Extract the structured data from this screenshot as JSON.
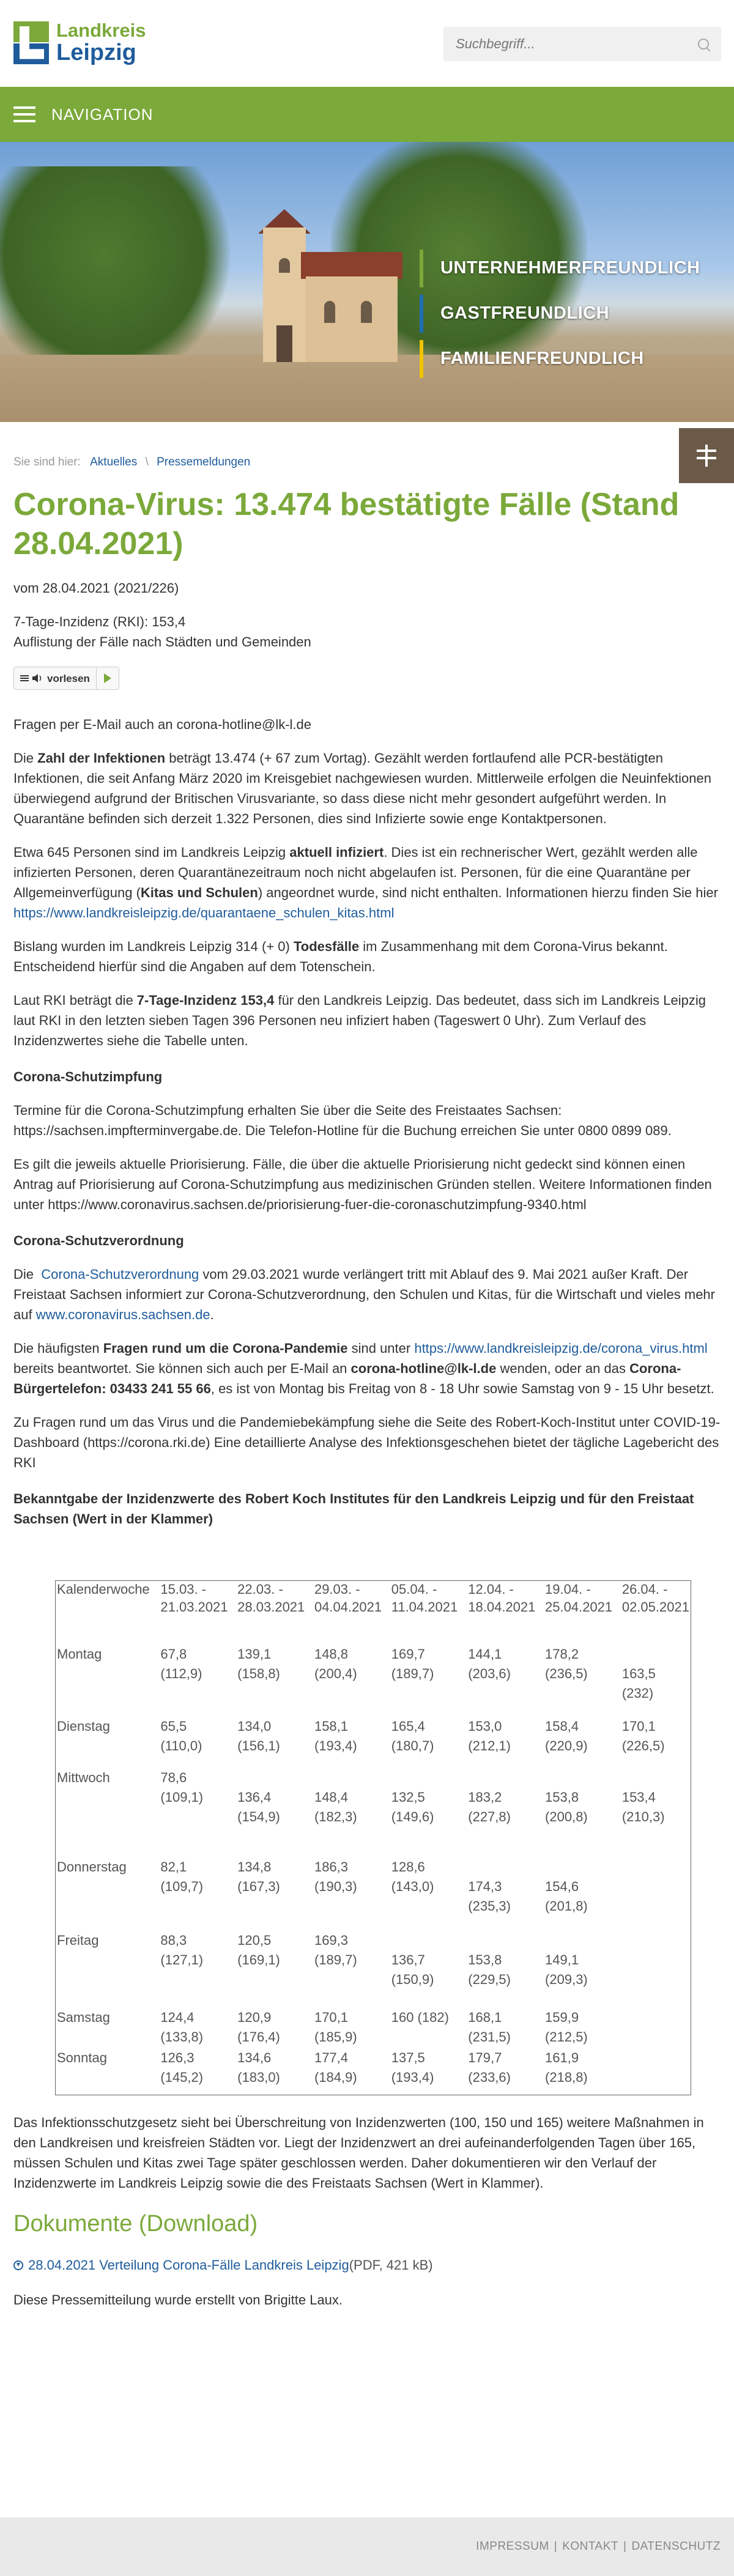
{
  "header": {
    "logo_top": "Landkreis",
    "logo_bottom": "Leipzig",
    "search_placeholder": "Suchbegriff..."
  },
  "nav": {
    "label": "NAVIGATION"
  },
  "hero": {
    "slogans": [
      "UNTERNEHMERFREUNDLICH",
      "GASTFREUNDLICH",
      "FAMILIENFREUNDLICH"
    ]
  },
  "breadcrumb": {
    "prefix": "Sie sind hier:",
    "items": [
      "Aktuelles",
      "Pressemeldungen"
    ],
    "separator": "\\"
  },
  "article": {
    "title": "Corona-Virus: 13.474 bestätigte Fälle (Stand 28.04.2021)",
    "date": "vom 28.04.2021 (2021/226)",
    "incidence_line": "7-Tage-Inzidenz (RKI): 153,4",
    "list_line": "Auflistung der Fälle nach Städten und Gemeinden",
    "listen_label": "vorlesen",
    "email_line": "Fragen per E-Mail auch an corona-hotline@lk-l.de",
    "p_infections_a": "Die ",
    "p_infections_b": "Zahl der Infektionen",
    "p_infections_c": " beträgt 13.474 (+ 67 zum Vortag). Gezählt werden fortlaufend alle PCR-bestätigten Infektionen, die seit Anfang März 2020 im Kreisgebiet nachgewiesen wurden. Mittlerweile erfolgen die Neuinfektionen überwiegend aufgrund der Britischen Virusvariante, so dass diese nicht mehr gesondert aufgeführt werden. In Quarantäne befinden sich derzeit 1.322 Personen, dies sind Infizierte sowie enge Kontaktpersonen.",
    "p_active_a": "Etwa 645 Personen sind im Landkreis Leipzig ",
    "p_active_b": "aktuell infiziert",
    "p_active_c": ". Dies ist ein rechnerischer Wert, gezählt werden alle infizierten Personen, deren Quarantänezeitraum noch nicht abgelaufen ist. Personen, für die eine Quarantäne per Allgemeinverfügung (",
    "p_active_d": "Kitas und Schulen",
    "p_active_e": ") angeordnet wurde, sind nicht enthalten. Informationen hierzu finden Sie hier ",
    "p_active_link": "https://www.landkreisleipzig.de/quarantaene_schulen_kitas.html",
    "p_deaths_a": "Bislang wurden im Landkreis Leipzig 314 (+ 0) ",
    "p_deaths_b": "Todesfälle",
    "p_deaths_c": " im Zusammenhang mit dem Corona-Virus bekannt. Entscheidend hierfür sind die Angaben auf dem Totenschein.",
    "p_rki_a": "Laut RKI beträgt die ",
    "p_rki_b": "7-Tage-Inzidenz 153,4",
    "p_rki_c": " für den Landkreis Leipzig. Das bedeutet, dass sich im Landkreis Leipzig laut RKI in den letzten sieben Tagen 396 Personen neu infiziert haben (Tageswert 0 Uhr). Zum Verlauf des Inzidenzwertes siehe die Tabelle unten.",
    "h_vaccination": "Corona-Schutzimpfung",
    "p_vacc1": "Termine für die Corona-Schutzimpfung erhalten Sie über die Seite des Freistaates Sachsen: https://sachsen.impfterminvergabe.de. Die Telefon-Hotline für die Buchung erreichen Sie unter 0800 0899 089.",
    "p_vacc2": "Es gilt die jeweils aktuelle Priorisierung. Fälle, die über die aktuelle Priorisierung nicht gedeckt sind können einen Antrag auf Priorisierung auf Corona-Schutzimpfung aus medizinischen Gründen stellen. Weitere Informationen finden unter https://www.coronavirus.sachsen.de/priorisierung-fuer-die-coronaschutzimpfung-9340.html",
    "h_regulation": "Corona-Schutzverordnung",
    "p_reg_a": "Die  ",
    "p_reg_link1": "Corona-Schutzverordnung",
    "p_reg_b": " vom 29.03.2021 wurde verlängert tritt mit Ablauf des 9. Mai 2021 außer Kraft. Der Freistaat Sachsen informiert zur Corona-Schutzverordnung, den Schulen und Kitas, für die Wirtschaft und vieles mehr auf ",
    "p_reg_link2": "www.coronavirus.sachsen.de",
    "p_reg_c": ".",
    "p_faq_a": "Die häufigsten ",
    "p_faq_b": "Fragen rund um die Corona-Pandemie",
    "p_faq_c": " sind unter ",
    "p_faq_link": "https://www.landkreisleipzig.de/corona_virus.html",
    "p_faq_d": " bereits beantwortet. Sie können sich auch per E-Mail an ",
    "p_faq_e": "corona-hotline@lk-l.de",
    "p_faq_f": " wenden, oder an das ",
    "p_faq_g": "Corona-Bürgertelefon: 03433 241 55 66",
    "p_faq_h": ", es ist von Montag bis Freitag von 8 - 18 Uhr sowie Samstag von 9 - 15 Uhr besetzt.",
    "p_rki_site": "Zu Fragen rund um das Virus und die Pandemiebekämpfung siehe die Seite des Robert-Koch-Institut unter COVID-19-Dashboard (https://corona.rki.de)  Eine detaillierte Analyse des Infektionsgeschehen bietet der tägliche Lagebericht des RKI",
    "table_heading": "Bekanntgabe der Inzidenzwerte des Robert Koch Institutes für den Landkreis Leipzig und für den Freistaat Sachsen (Wert in der Klammer)",
    "p_law": "Das Infektionsschutzgesetz sieht bei Überschreitung von Inzidenzwerten (100, 150 und 165) weitere Maßnahmen in den Landkreisen und kreisfreien Städten vor. Liegt der Inzidenzwert an drei aufeinanderfolgenden Tagen über 165, müssen Schulen und Kitas zwei Tage später geschlossen werden. Daher dokumentieren wir den Verlauf der Inzidenzwerte im Landkreis Leipzig sowie die des Freistaats Sachsen (Wert in Klammer).",
    "h_documents": "Dokumente (Download)",
    "doc_link": "28.04.2021 Verteilung Corona-Fälle Landkreis Leipzig",
    "doc_meta": " (PDF, 421 kB)",
    "author": "Diese Pressemitteilung wurde erstellt von Brigitte Laux."
  },
  "incidence_table": {
    "header_label": "Kalenderwoche",
    "weeks": [
      [
        "15.03. -",
        "21.03.2021"
      ],
      [
        "22.03. -",
        "28.03.2021"
      ],
      [
        "29.03. -",
        "04.04.2021"
      ],
      [
        "05.04. -",
        "11.04.2021"
      ],
      [
        "12.04. -",
        "18.04.2021"
      ],
      [
        "19.04. -",
        "25.04.2021"
      ],
      [
        "26.04. -",
        "02.05.2021"
      ]
    ],
    "rows": [
      {
        "day": "Montag",
        "cells": [
          [
            "67,8",
            "(112,9)"
          ],
          [
            "139,1",
            "(158,8)"
          ],
          [
            "148,8",
            "(200,4)"
          ],
          [
            "169,7",
            "(189,7)"
          ],
          [
            "144,1",
            "(203,6)"
          ],
          [
            "178,2",
            "(236,5)"
          ],
          [
            "",
            "163,5 (232)"
          ]
        ]
      },
      {
        "day": "Dienstag",
        "cells": [
          [
            "65,5",
            "(110,0)"
          ],
          [
            "134,0",
            "(156,1)"
          ],
          [
            "158,1",
            "(193,4)"
          ],
          [
            "165,4",
            "(180,7)"
          ],
          [
            "153,0",
            "(212,1)"
          ],
          [
            "158,4",
            "(220,9)"
          ],
          [
            "170,1",
            "(226,5)"
          ]
        ]
      },
      {
        "day": "Mittwoch",
        "cells": [
          [
            "78,6",
            "(109,1)"
          ],
          [
            "",
            "136,4",
            "(154,9)"
          ],
          [
            "",
            "148,4",
            "(182,3)"
          ],
          [
            "",
            "132,5",
            "(149,6)"
          ],
          [
            "",
            "183,2",
            "(227,8)"
          ],
          [
            "",
            "153,8",
            "(200,8)"
          ],
          [
            "",
            "153,4",
            "(210,3)"
          ]
        ]
      },
      {
        "day": "Donnerstag",
        "cells": [
          [
            "82,1",
            "(109,7)"
          ],
          [
            "134,8",
            "(167,3)"
          ],
          [
            "186,3",
            "(190,3)"
          ],
          [
            "128,6",
            "(143,0)"
          ],
          [
            "",
            "174,3",
            "(235,3)"
          ],
          [
            "",
            "154,6",
            "(201,8)"
          ],
          [
            ""
          ]
        ]
      },
      {
        "day": "Freitag",
        "cells": [
          [
            "88,3",
            "(127,1)"
          ],
          [
            "120,5",
            "(169,1)"
          ],
          [
            "169,3",
            "(189,7)"
          ],
          [
            "",
            "136,7",
            "(150,9)"
          ],
          [
            "",
            "153,8",
            "(229,5)"
          ],
          [
            "",
            "149,1",
            "(209,3)"
          ],
          [
            ""
          ]
        ]
      },
      {
        "day": "Samstag",
        "cells": [
          [
            "124,4",
            "(133,8)"
          ],
          [
            "120,9",
            "(176,4)"
          ],
          [
            "170,1",
            "(185,9)"
          ],
          [
            "160 (182)"
          ],
          [
            "168,1",
            "(231,5)"
          ],
          [
            "159,9",
            "(212,5)"
          ],
          [
            ""
          ]
        ]
      },
      {
        "day": "Sonntag",
        "cells": [
          [
            "126,3",
            "(145,2)"
          ],
          [
            "134,6",
            "(183,0)"
          ],
          [
            "177,4",
            "(184,9)"
          ],
          [
            "137,5",
            "(193,4)"
          ],
          [
            "179,7",
            "(233,6)"
          ],
          [
            "161,9",
            "(218,8)"
          ],
          [
            ""
          ]
        ]
      }
    ]
  },
  "footer": {
    "links": [
      "IMPRESSUM",
      "KONTAKT",
      "DATENSCHUTZ"
    ],
    "separator": "|"
  },
  "colors": {
    "brand_green": "#7ba93a",
    "brand_blue": "#1f5c9c",
    "accent_yellow": "#f2c300"
  }
}
